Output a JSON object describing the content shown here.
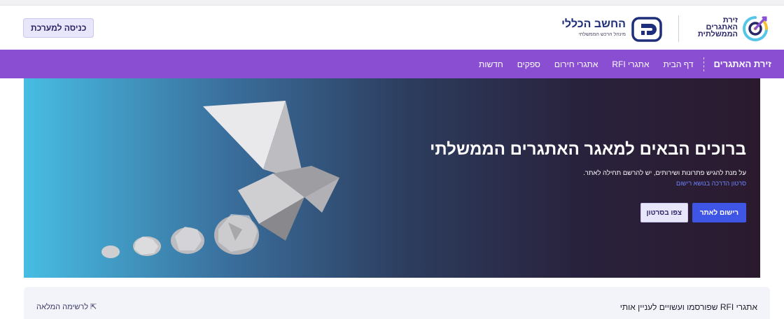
{
  "header": {
    "login_label": "כניסה למערכת",
    "zirat_logo": [
      "זירת",
      "האתגרים",
      "הממשלתית"
    ],
    "ag_logo_name": "החשב הכללי",
    "ag_logo_sub": "מינהל הרכש הממשלתי"
  },
  "nav": {
    "brand": "זירת האתגרים",
    "items": [
      "דף הבית",
      "אתגרי RFI",
      "אתגרי חירום",
      "ספקים",
      "חדשות"
    ]
  },
  "hero": {
    "title": "ברוכים הבאים למאגר האתגרים הממשלתי",
    "description": "על מנת להגיש פתרונות ושירותים, יש להרשם תחילה לאתר.",
    "guide_link": "סרטון הדרכה בנושא רישום",
    "register_label": "רישום לאתר",
    "video_label": "צפו בסרטון"
  },
  "panel": {
    "title": "אתגרי RFI שפורסמו ועשויים לעניין אותי",
    "full_list_link": "⇱ לרשימה המלאה"
  },
  "colors": {
    "nav_bg": "#8a4ed3",
    "primary_button": "#3f55e6",
    "brand_navy": "#2a2668"
  }
}
